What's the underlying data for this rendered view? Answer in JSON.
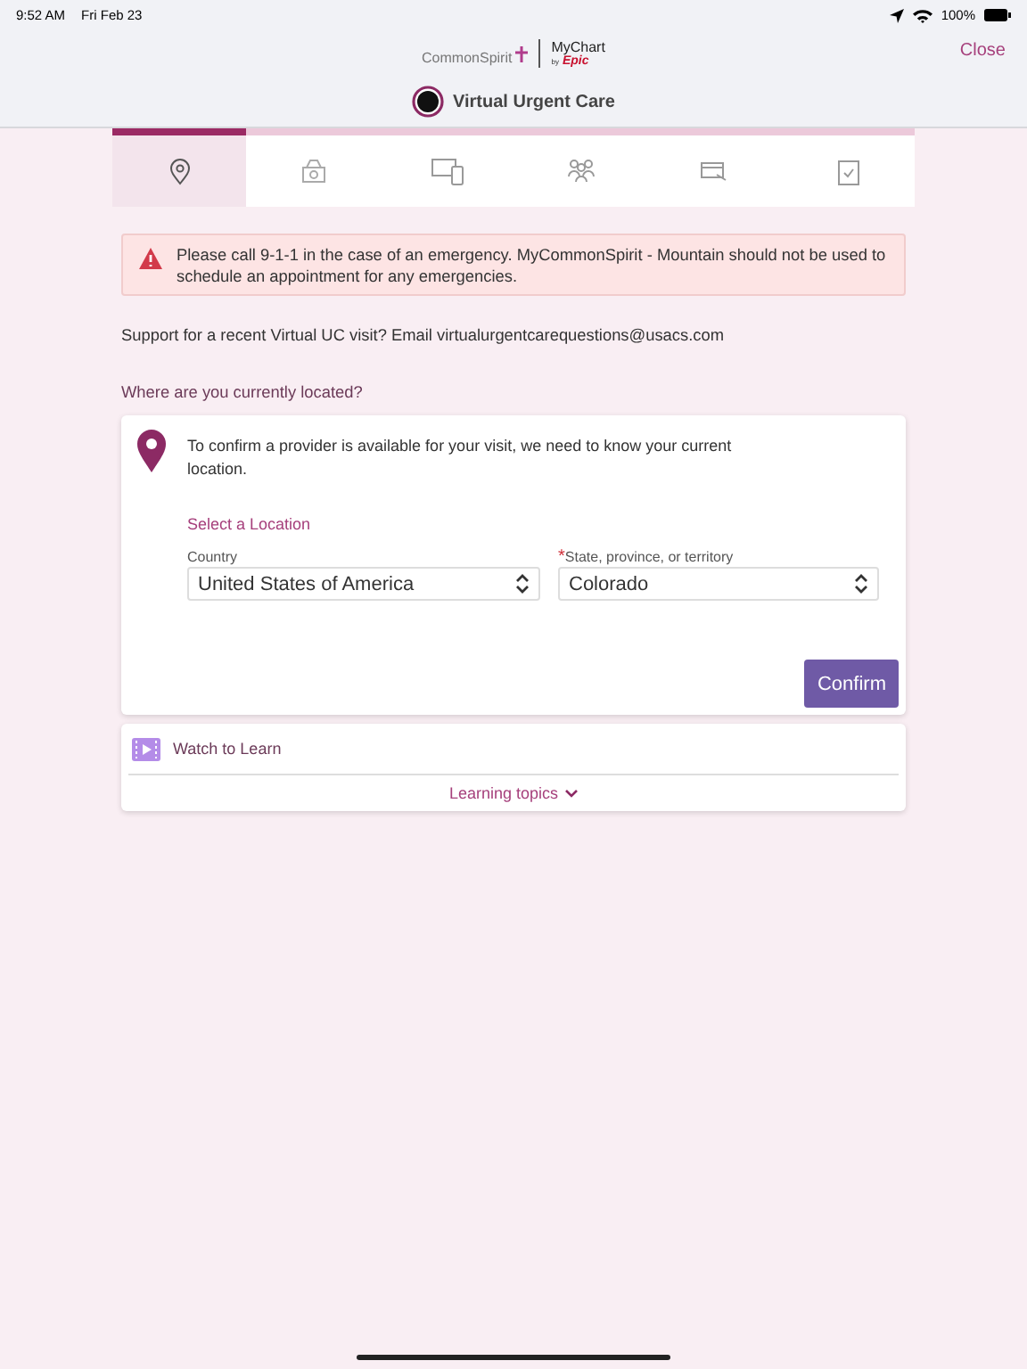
{
  "status_bar": {
    "time": "9:52 AM",
    "date": "Fri Feb 23",
    "battery": "100%"
  },
  "header": {
    "logo_left": "CommonSpirit",
    "logo_right": "MyChart",
    "logo_by": "by",
    "logo_epic": "Epic",
    "close": "Close",
    "title": "Virtual Urgent Care"
  },
  "steps": [
    {
      "kind": "location",
      "selected": true
    },
    {
      "kind": "bag",
      "selected": false
    },
    {
      "kind": "devices",
      "selected": false
    },
    {
      "kind": "people",
      "selected": false
    },
    {
      "kind": "card",
      "selected": false
    },
    {
      "kind": "clipboard",
      "selected": false
    }
  ],
  "alert": "Please call 9-1-1 in the case of an emergency. MyCommonSpirit - Mountain should not be used to schedule an appointment for any emergencies.",
  "support": "Support for a recent Virtual UC visit? Email virtualurgentcarequestions@usacs.com",
  "question": "Where are you currently located?",
  "location_card": {
    "intro": "To confirm a provider is available for your visit, we need to know your current location.",
    "select_heading": "Select a Location",
    "fields": [
      {
        "label": "Country",
        "value": "United States of America"
      },
      {
        "label": "State, province, or territory",
        "value": "Colorado",
        "required_mark": "*"
      }
    ],
    "confirm": "Confirm"
  },
  "learn": {
    "title": "Watch to Learn",
    "topics": "Learning topics"
  }
}
